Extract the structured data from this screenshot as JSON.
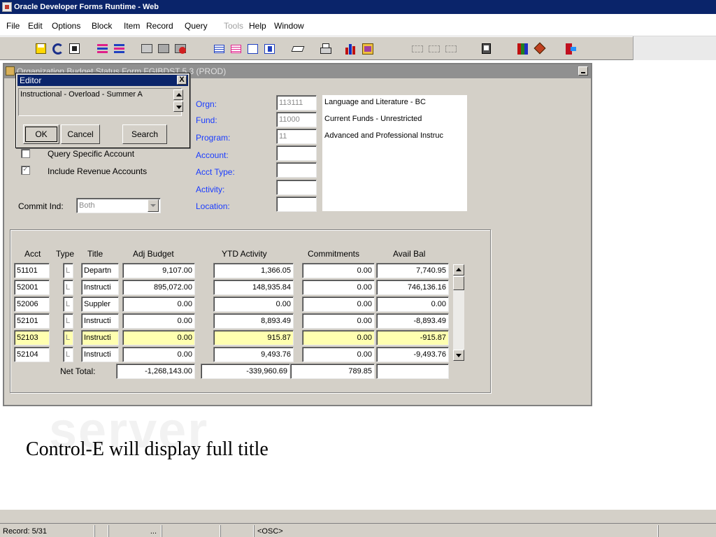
{
  "app": {
    "title": "Oracle Developer Forms Runtime - Web"
  },
  "menu": [
    {
      "label": "File",
      "enabled": true
    },
    {
      "label": "Edit",
      "enabled": true
    },
    {
      "label": "Options",
      "enabled": true
    },
    {
      "label": "Block",
      "enabled": true
    },
    {
      "label": "Item",
      "enabled": true
    },
    {
      "label": "Record",
      "enabled": true
    },
    {
      "label": "Query",
      "enabled": true
    },
    {
      "label": "Tools",
      "enabled": false
    },
    {
      "label": "Help",
      "enabled": true
    },
    {
      "label": "Window",
      "enabled": true
    }
  ],
  "toolbar": {
    "icons": [
      "save-icon",
      "undo-icon",
      "exit-icon",
      "previous-block-icon",
      "next-block-icon",
      "enter-query-icon",
      "execute-query-icon",
      "cancel-query-icon",
      "previous-record-icon",
      "next-record-icon",
      "insert-record-icon",
      "delete-record-icon",
      "edit-icon",
      "print-icon",
      "chart-icon",
      "calculator-icon",
      "tree-icon-1",
      "tree-icon-2",
      "tree-icon-3",
      "copy-icon",
      "help-book-icon",
      "diamond-icon",
      "exit-door-icon"
    ]
  },
  "form": {
    "title": "Organization Budget Status Form  FGIBDST 5.3  (PROD)",
    "fields": {
      "orgn": {
        "label": "Orgn:",
        "value": "113111",
        "desc": "Language and Literature - BC"
      },
      "fund": {
        "label": "Fund:",
        "value": "11000",
        "desc": "Current Funds - Unrestricted"
      },
      "program": {
        "label": "Program:",
        "value": "11",
        "desc": "Advanced and Professional Instruc"
      },
      "account": {
        "label": "Account:",
        "value": ""
      },
      "acct_type": {
        "label": "Acct Type:",
        "value": ""
      },
      "activity": {
        "label": "Activity:",
        "value": ""
      },
      "location": {
        "label": "Location:",
        "value": ""
      }
    },
    "query_specific_account": {
      "label": "Query Specific Account",
      "checked": false
    },
    "include_revenue_accounts": {
      "label": "Include Revenue Accounts",
      "checked": true
    },
    "commit_ind": {
      "label": "Commit Ind:",
      "value": "Both"
    }
  },
  "grid": {
    "headers": [
      "Acct",
      "Type",
      "Title",
      "Adj Budget",
      "YTD Activity",
      "Commitments",
      "Avail Bal"
    ],
    "rows": [
      {
        "acct": "51101",
        "type": "L",
        "title": "Departn",
        "adj_budget": "9,107.00",
        "ytd": "1,366.05",
        "commit": "0.00",
        "avail": "7,740.95",
        "selected": false
      },
      {
        "acct": "52001",
        "type": "L",
        "title": "Instructi",
        "adj_budget": "895,072.00",
        "ytd": "148,935.84",
        "commit": "0.00",
        "avail": "746,136.16",
        "selected": false
      },
      {
        "acct": "52006",
        "type": "L",
        "title": "Suppler",
        "adj_budget": "0.00",
        "ytd": "0.00",
        "commit": "0.00",
        "avail": "0.00",
        "selected": false
      },
      {
        "acct": "52101",
        "type": "L",
        "title": "Instructi",
        "adj_budget": "0.00",
        "ytd": "8,893.49",
        "commit": "0.00",
        "avail": "-8,893.49",
        "selected": false
      },
      {
        "acct": "52103",
        "type": "L",
        "title": "Instructi",
        "adj_budget": "0.00",
        "ytd": "915.87",
        "commit": "0.00",
        "avail": "-915.87",
        "selected": true
      },
      {
        "acct": "52104",
        "type": "L",
        "title": "Instructi",
        "adj_budget": "0.00",
        "ytd": "9,493.76",
        "commit": "0.00",
        "avail": "-9,493.76",
        "selected": false
      }
    ],
    "net_total": {
      "label": "Net Total:",
      "adj_budget": "-1,268,143.00",
      "ytd": "-339,960.69",
      "commit": "789.85",
      "avail": ""
    }
  },
  "editor": {
    "title": "Editor",
    "close": "X",
    "text": "Instructional - Overload - Summer A",
    "ok": "OK",
    "cancel": "Cancel",
    "search": "Search"
  },
  "caption": "Control-E will display full title",
  "watermark": "server",
  "status": {
    "record": "Record: 5/31",
    "ellipsis": "...",
    "osc": "<OSC>"
  },
  "colors": {
    "title_bar": "#0a246a",
    "window_face": "#d4d0c8",
    "label_blue": "#1a3cff",
    "selected_row": "#ffffb0",
    "inactive_form_title": "#909090"
  }
}
